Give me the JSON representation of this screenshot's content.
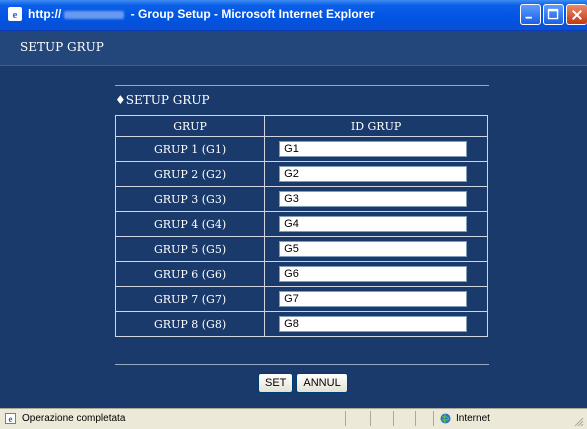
{
  "window": {
    "title_prefix": "http://",
    "title_suffix": " - Group Setup - Microsoft Internet Explorer"
  },
  "page": {
    "title": "SETUP GRUP"
  },
  "section": {
    "title": "♦SETUP GRUP"
  },
  "table": {
    "headers": [
      "GRUP",
      "ID GRUP"
    ],
    "rows": [
      {
        "label": "GRUP 1 (G1)",
        "value": "G1"
      },
      {
        "label": "GRUP 2 (G2)",
        "value": "G2"
      },
      {
        "label": "GRUP 3 (G3)",
        "value": "G3"
      },
      {
        "label": "GRUP 4 (G4)",
        "value": "G4"
      },
      {
        "label": "GRUP 5 (G5)",
        "value": "G5"
      },
      {
        "label": "GRUP 6 (G6)",
        "value": "G6"
      },
      {
        "label": "GRUP 7 (G7)",
        "value": "G7"
      },
      {
        "label": "GRUP 8 (G8)",
        "value": "G8"
      }
    ]
  },
  "buttons": {
    "set": "SET",
    "cancel": "ANNUL"
  },
  "status": {
    "text": "Operazione completata",
    "zone": "Internet"
  },
  "colors": {
    "titlebar": "#0054e3",
    "page_bg": "#1a3a6c",
    "header_bg": "#23477a"
  }
}
